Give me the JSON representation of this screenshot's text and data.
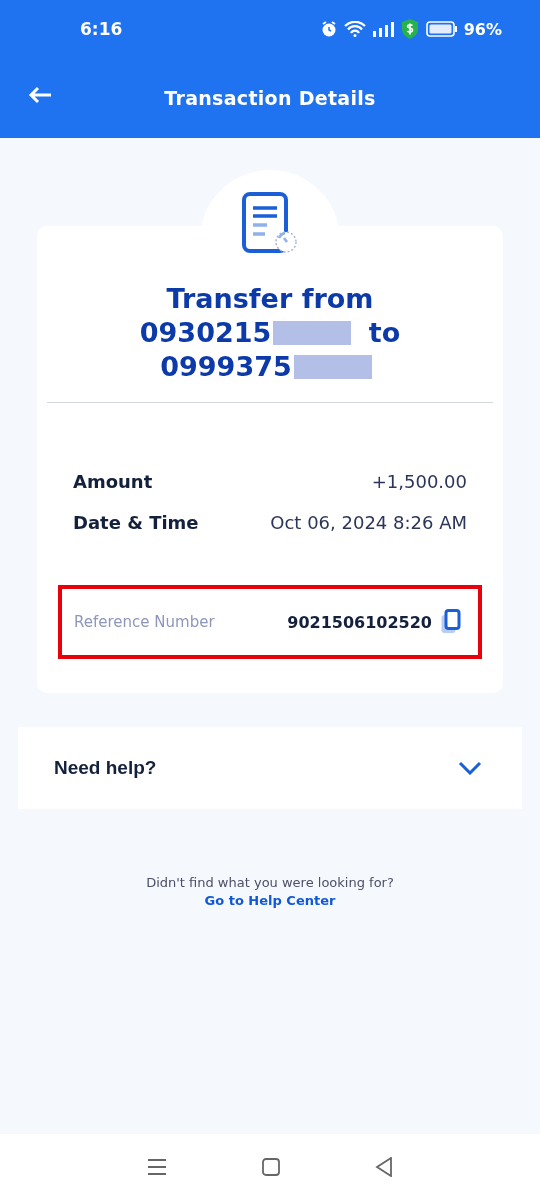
{
  "status_bar": {
    "time": "6:16",
    "battery": "96%"
  },
  "header": {
    "title": "Transaction Details"
  },
  "receipt": {
    "title": [
      {
        "text": "Transfer from",
        "redacted": false
      },
      {
        "text": "0930215",
        "redacted": true
      },
      {
        "text": "to",
        "redacted": false
      },
      {
        "text": "0999375",
        "redacted": true
      }
    ],
    "details": [
      {
        "label": "Amount",
        "value": "+1,500.00"
      },
      {
        "label": "Date & Time",
        "value": "Oct 06, 2024 8:26 AM"
      }
    ],
    "reference": {
      "label": "Reference Number",
      "value": "9021506102520",
      "highlighted": true
    }
  },
  "help": {
    "title": "Need help?",
    "expanded": false
  },
  "footer": {
    "text": "Didn't find what you were looking for?",
    "link": "Go to Help Center"
  }
}
